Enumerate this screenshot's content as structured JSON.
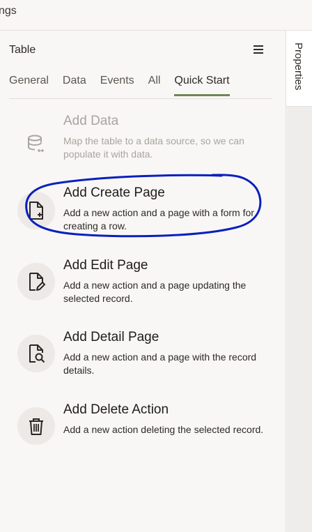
{
  "header": {
    "title": "ngs"
  },
  "panel": {
    "title": "Table",
    "tabs": [
      {
        "label": "General",
        "active": false
      },
      {
        "label": "Data",
        "active": false
      },
      {
        "label": "Events",
        "active": false
      },
      {
        "label": "All",
        "active": false
      },
      {
        "label": "Quick Start",
        "active": true
      }
    ],
    "items": [
      {
        "label": "Add Data",
        "desc": "Map the table to a data source, so we can populate it with data.",
        "icon": "database-icon",
        "enabled": false
      },
      {
        "label": "Add Create Page",
        "desc": "Add a new action and a page with a form for creating a row.",
        "icon": "create-page-icon",
        "enabled": true
      },
      {
        "label": "Add Edit Page",
        "desc": "Add a new action and a page updating the selected record.",
        "icon": "edit-page-icon",
        "enabled": true
      },
      {
        "label": "Add Detail Page",
        "desc": "Add a new action and a page with the record details.",
        "icon": "detail-page-icon",
        "enabled": true
      },
      {
        "label": "Add Delete Action",
        "desc": "Add a new action deleting the selected record.",
        "icon": "trash-icon",
        "enabled": true
      }
    ]
  },
  "right_rail": {
    "properties_label": "Properties"
  },
  "colors": {
    "active_tab_underline": "#6f8554",
    "annotation": "#0a1fbf"
  }
}
